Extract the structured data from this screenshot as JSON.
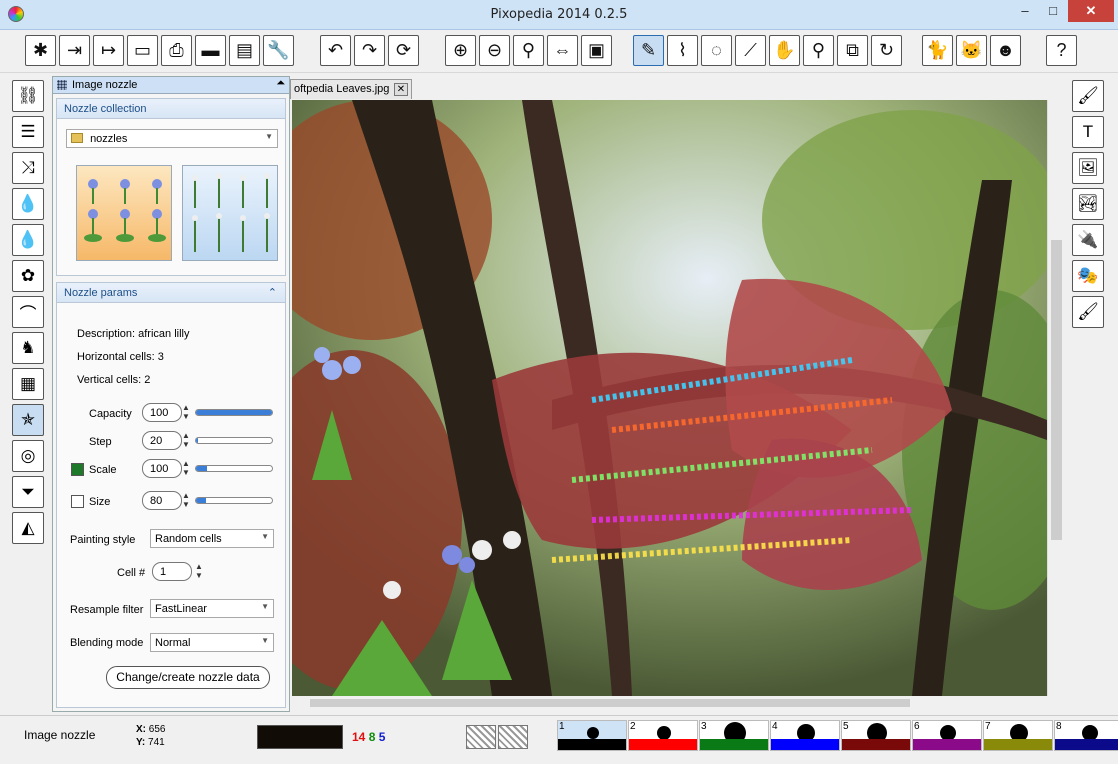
{
  "window": {
    "title": "Pixopedia 2014 0.2.5",
    "min": "–",
    "max": "□",
    "close": "✕"
  },
  "toolbar": {
    "items": [
      {
        "name": "new-file-icon",
        "glyph": "✱"
      },
      {
        "name": "import-icon",
        "glyph": "⇥"
      },
      {
        "name": "export-icon",
        "glyph": "↦"
      },
      {
        "name": "open-folder-icon",
        "glyph": "▭"
      },
      {
        "name": "print-icon",
        "glyph": "⎙"
      },
      {
        "name": "stapler-icon",
        "glyph": "▬"
      },
      {
        "name": "clipboard-icon",
        "glyph": "▤"
      },
      {
        "name": "wrench-icon",
        "glyph": "🔧"
      },
      {
        "name": "undo-icon",
        "glyph": "↶"
      },
      {
        "name": "redo-icon",
        "glyph": "↷"
      },
      {
        "name": "refresh-icon",
        "glyph": "⟳"
      },
      {
        "name": "zoom-in-icon",
        "glyph": "⊕"
      },
      {
        "name": "zoom-out-icon",
        "glyph": "⊖"
      },
      {
        "name": "zoom-icon",
        "glyph": "⚲"
      },
      {
        "name": "fit-window-icon",
        "glyph": "⇔"
      },
      {
        "name": "fullscreen-icon",
        "glyph": "▣"
      },
      {
        "name": "pen-icon",
        "glyph": "✎"
      },
      {
        "name": "path-icon",
        "glyph": "⌇"
      },
      {
        "name": "ellipse-select-icon",
        "glyph": "◌"
      },
      {
        "name": "eyedropper-icon",
        "glyph": "⟋"
      },
      {
        "name": "hand-icon",
        "glyph": "✋"
      },
      {
        "name": "search-icon",
        "glyph": "⚲"
      },
      {
        "name": "crop-icon",
        "glyph": "⧉"
      },
      {
        "name": "rotate-icon",
        "glyph": "↻"
      },
      {
        "name": "cat-black-icon",
        "glyph": "🐈"
      },
      {
        "name": "cat-white-icon",
        "glyph": "🐱"
      },
      {
        "name": "mask-icon",
        "glyph": "☻"
      },
      {
        "name": "help-icon",
        "glyph": "?"
      }
    ]
  },
  "left_tools": [
    {
      "name": "chain-icon",
      "glyph": "⛓"
    },
    {
      "name": "levels-icon",
      "glyph": "☰"
    },
    {
      "name": "shuffle-icon",
      "glyph": "⤨"
    },
    {
      "name": "drop-gear-icon",
      "glyph": "💧"
    },
    {
      "name": "drop-three-icon",
      "glyph": "💧"
    },
    {
      "name": "flower-icon",
      "glyph": "✿"
    },
    {
      "name": "rainbow-icon",
      "glyph": "⌒"
    },
    {
      "name": "horse-icon",
      "glyph": "♞"
    },
    {
      "name": "grid-icon",
      "glyph": "▦"
    },
    {
      "name": "image-nozzle-icon",
      "glyph": "✯"
    },
    {
      "name": "spiral-icon",
      "glyph": "◎"
    },
    {
      "name": "filter-icon",
      "glyph": "⏷"
    },
    {
      "name": "pizza-icon",
      "glyph": "◭"
    }
  ],
  "right_tools": [
    {
      "name": "brush-icon",
      "glyph": "🖌"
    },
    {
      "name": "text-icon",
      "glyph": "T"
    },
    {
      "name": "image-frame-icon",
      "glyph": "🖼"
    },
    {
      "name": "picture-icon",
      "glyph": "🏞"
    },
    {
      "name": "plug-icon",
      "glyph": "🔌"
    },
    {
      "name": "theater-masks-icon",
      "glyph": "🎭"
    },
    {
      "name": "paint-brush-icon",
      "glyph": "🖌"
    }
  ],
  "panel": {
    "title": "Image nozzle",
    "collection": {
      "header": "Nozzle collection",
      "folder": "nozzles"
    },
    "params": {
      "header": "Nozzle params",
      "description": "Description: african lilly",
      "horizontal": "Horizontal cells: 3",
      "vertical": "Vertical cells: 2",
      "capacity": {
        "label": "Capacity",
        "value": "100",
        "level": 1.0
      },
      "step": {
        "label": "Step",
        "value": "20",
        "level": 0.02
      },
      "scale": {
        "label": "Scale",
        "value": "100",
        "level": 0.15
      },
      "size": {
        "label": "Size",
        "value": "80",
        "level": 0.13
      },
      "painting_style": {
        "label": "Painting style",
        "value": "Random cells"
      },
      "cell": {
        "label": "Cell #",
        "value": "1"
      },
      "resample": {
        "label": "Resample filter",
        "value": "FastLinear"
      },
      "blending": {
        "label": "Blending mode",
        "value": "Normal"
      },
      "button": "Change/create nozzle data"
    }
  },
  "document_tab": {
    "label": "oftpedia Leaves.jpg",
    "close": "✕"
  },
  "status": {
    "tool": "Image nozzle",
    "x_label": "X:",
    "x": "656",
    "y_label": "Y:",
    "y": "741",
    "r": "14",
    "g": "8",
    "b": "5"
  },
  "brushes": [
    {
      "num": "1",
      "color": "#000000",
      "size": 12,
      "selected": true
    },
    {
      "num": "2",
      "color": "#ff0000",
      "size": 14
    },
    {
      "num": "3",
      "color": "#0a7a16",
      "size": 22
    },
    {
      "num": "4",
      "color": "#0000ff",
      "size": 18
    },
    {
      "num": "5",
      "color": "#7a0a0a",
      "size": 20
    },
    {
      "num": "6",
      "color": "#8a0a8a",
      "size": 16
    },
    {
      "num": "7",
      "color": "#8a8a0a",
      "size": 18
    },
    {
      "num": "8",
      "color": "#0a0a8a",
      "size": 16
    }
  ],
  "colors": {
    "accent": "#3a7ed8",
    "title_bg": "#cfe3f7",
    "close": "#c7423a"
  }
}
